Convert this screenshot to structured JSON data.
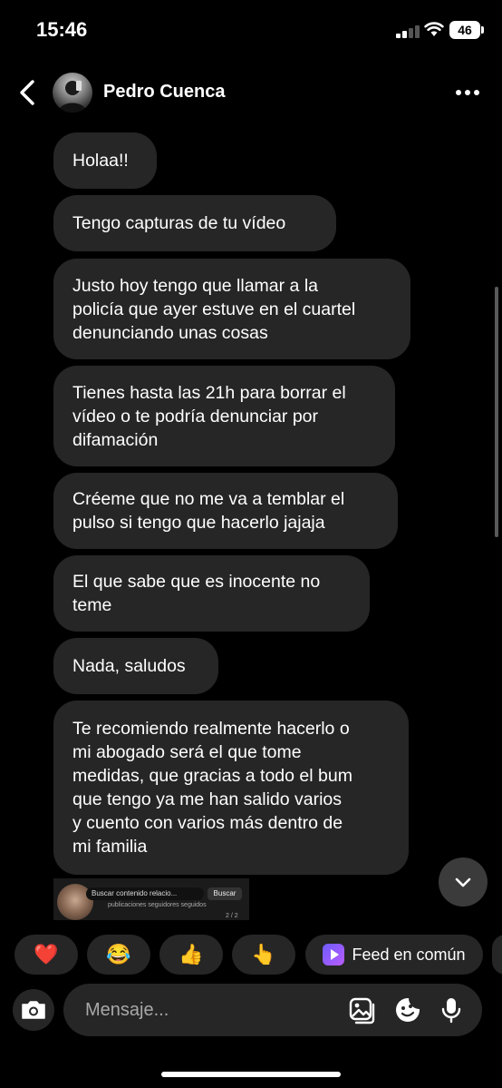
{
  "status": {
    "time": "15:46",
    "battery": "46"
  },
  "header": {
    "name": "Pedro Cuenca"
  },
  "messages": [
    "Holaa!!",
    "Tengo capturas de tu vídeo",
    "Justo hoy tengo que llamar a la\npolicía que ayer estuve en el cuartel\ndenunciando unas cosas",
    "Tienes hasta las 21h para borrar el\nvídeo o te podría denunciar por\ndifamación",
    "Créeme que no me va a temblar el\npulso si tengo que hacerlo jajaja",
    "El que sabe que es inocente no\nteme",
    "Nada, saludos",
    "Te recomiendo realmente hacerlo o\nmi abogado será el que tome\nmedidas, que gracias a todo el bum\nque tengo ya me han salido varios\ny cuento con varios más dentro de\nmi familia"
  ],
  "preview": {
    "search_text": "Buscar contenido relacio...",
    "button": "Buscar",
    "meta": "publicaciones   seguidores   seguidos",
    "page": "2 / 2"
  },
  "quick_replies": {
    "heart": "❤️",
    "laugh": "😂",
    "thumbs": "👍",
    "point": "👆",
    "feed_label": "Feed en común"
  },
  "composer": {
    "placeholder": "Mensaje..."
  }
}
